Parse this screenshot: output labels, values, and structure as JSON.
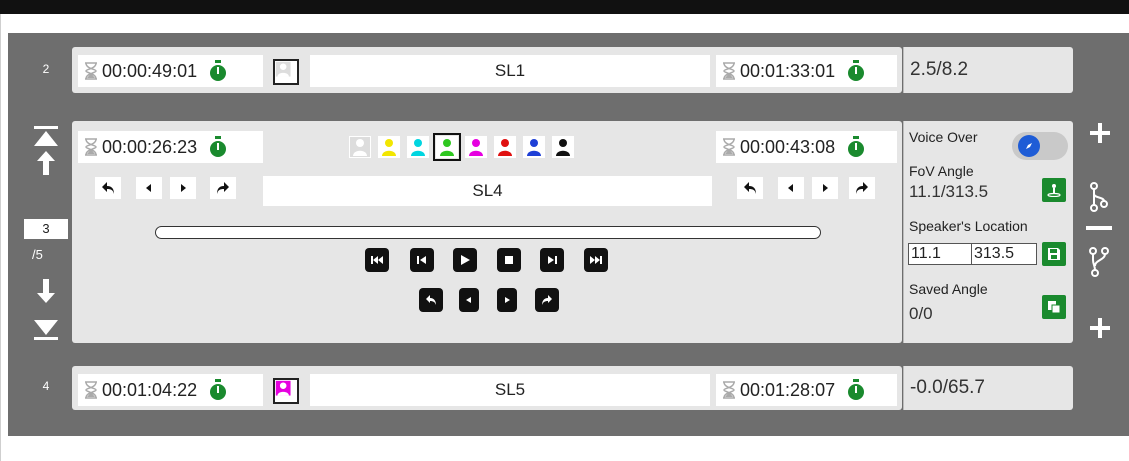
{
  "colors": {
    "panel": "#6e6e6e",
    "card": "#e6e6e6",
    "accent_green": "#1a8a2e",
    "toggle_knob": "#1e5cd6"
  },
  "rows": [
    {
      "number": "2",
      "start_time": "00:00:49:01",
      "label": "SL1",
      "end_time": "00:01:33:01",
      "angle": "2.5/8.2"
    },
    {
      "number": "4",
      "start_time": "00:01:04:22",
      "label": "SL5",
      "end_time": "00:01:28:07",
      "angle": "-0.0/65.7"
    }
  ],
  "active": {
    "start_time": "00:00:26:23",
    "label": "SL4",
    "end_time": "00:00:43:08",
    "speaker_colors": [
      "#ffffff",
      "#f2e600",
      "#00d5e0",
      "#2ec71f",
      "#e600e0",
      "#e01010",
      "#1e3fd6",
      "#111111"
    ],
    "selected_speaker_index": 3,
    "voice_over_label": "Voice Over",
    "fov_label": "FoV Angle",
    "fov_value": "11.1/313.5",
    "speaker_location_label": "Speaker's Location",
    "location_x": "11.1",
    "location_y": "313.5",
    "saved_angle_label": "Saved Angle",
    "saved_angle_value": "0/0"
  },
  "pager": {
    "current": "3",
    "total": "/5"
  },
  "icons": {
    "start": "hourglass-icon",
    "stopwatch": "stopwatch-icon",
    "speaker": "person-icon"
  }
}
